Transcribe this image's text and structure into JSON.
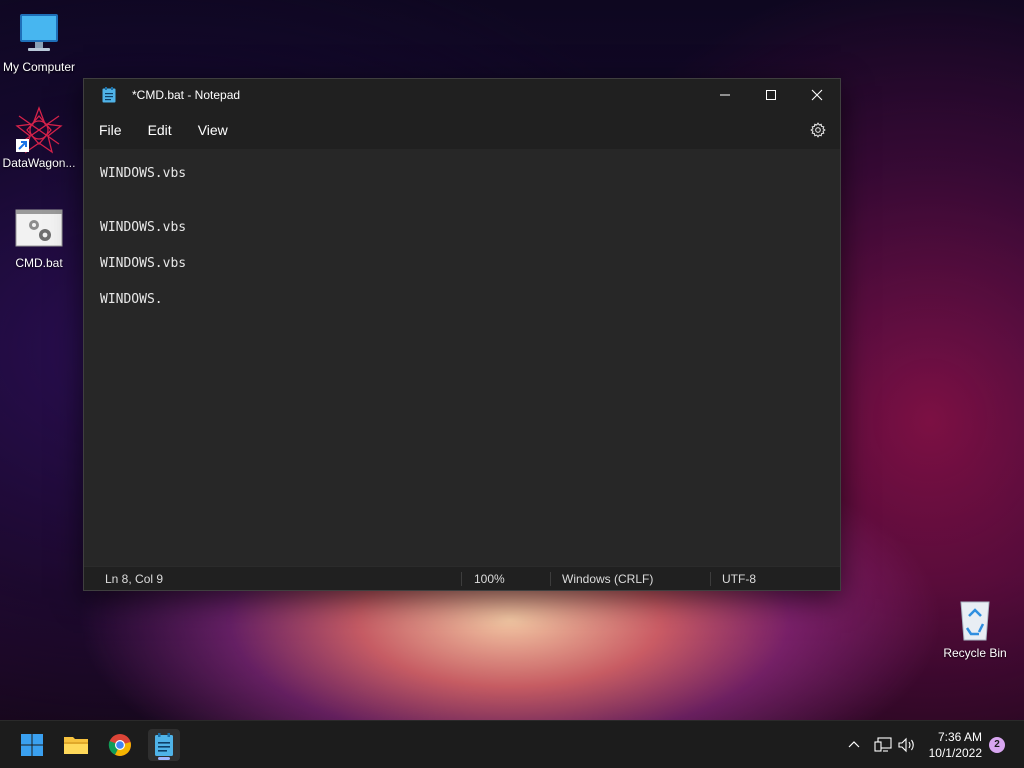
{
  "desktop": {
    "icons": [
      {
        "label": "My Computer"
      },
      {
        "label": "DataWagon..."
      },
      {
        "label": "CMD.bat"
      },
      {
        "label": "Recycle Bin"
      }
    ]
  },
  "window": {
    "title": "*CMD.bat - Notepad",
    "menu": [
      "File",
      "Edit",
      "View"
    ],
    "controls": {
      "minimize": "minimize-icon",
      "maximize": "maximize-icon",
      "close": "close-icon"
    },
    "lines": [
      "WINDOWS.vbs",
      "",
      "",
      "WINDOWS.vbs",
      "",
      "WINDOWS.vbs",
      "",
      "WINDOWS."
    ],
    "status": {
      "position": "Ln 8, Col 9",
      "zoom": "100%",
      "line_ending": "Windows (CRLF)",
      "encoding": "UTF-8"
    }
  },
  "taskbar": {
    "apps": [
      "start-icon",
      "file-explorer-icon",
      "chrome-icon",
      "notepad-icon"
    ],
    "clock": {
      "time": "7:36 AM",
      "date": "10/1/2022"
    },
    "notifications": "2"
  },
  "colors": {
    "window_bg": "#272727",
    "titlebar_bg": "#202020",
    "taskbar_bg": "#1c1c1c",
    "accent": "#0078d4"
  }
}
